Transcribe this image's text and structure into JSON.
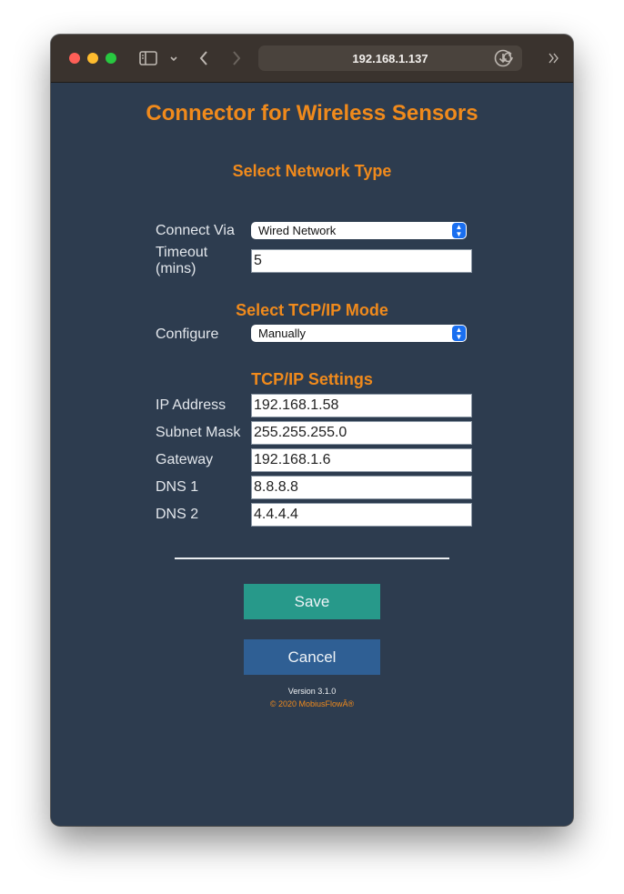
{
  "browser": {
    "url": "192.168.1.137",
    "icons": {
      "sidebar": "sidebar-icon",
      "chevron": "chevron-down-icon",
      "back": "back-icon",
      "forward": "forward-icon",
      "reload": "reload-icon",
      "download": "download-icon",
      "more": "double-chevron-right-icon"
    }
  },
  "app": {
    "title": "Connector for Wireless Sensors",
    "accent_color": "#f08a1c",
    "background_color": "#2d3c4f"
  },
  "network": {
    "section_title": "Select Network Type",
    "connect_via_label": "Connect Via",
    "connect_via_value": "Wired Network",
    "timeout_label_line1": "Timeout",
    "timeout_label_line2": "(mins)",
    "timeout_value": "5"
  },
  "tcpip_mode": {
    "section_title": "Select TCP/IP Mode",
    "configure_label": "Configure",
    "configure_value": "Manually"
  },
  "tcpip_settings": {
    "section_title": "TCP/IP Settings",
    "fields": [
      {
        "label": "IP Address",
        "value": "192.168.1.58"
      },
      {
        "label": "Subnet Mask",
        "value": "255.255.255.0"
      },
      {
        "label": "Gateway",
        "value": "192.168.1.6"
      },
      {
        "label": "DNS 1",
        "value": "8.8.8.8"
      },
      {
        "label": "DNS 2",
        "value": "4.4.4.4"
      }
    ]
  },
  "actions": {
    "save_label": "Save",
    "save_color": "#27998a",
    "cancel_label": "Cancel",
    "cancel_color": "#2f5f94"
  },
  "footer": {
    "version": "Version 3.1.0",
    "copyright": "© 2020 MobiusFlowÂ®"
  }
}
